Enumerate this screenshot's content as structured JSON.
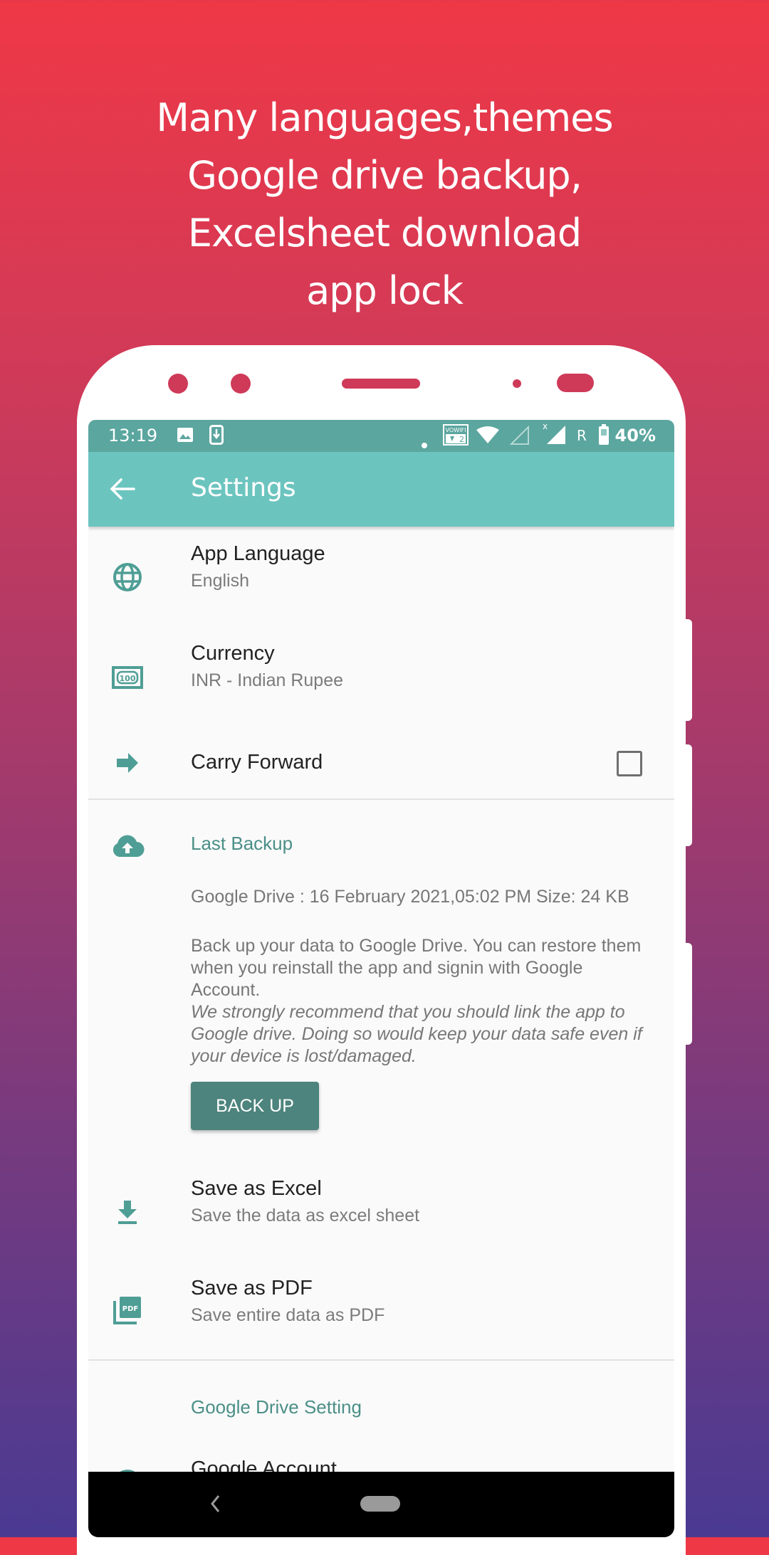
{
  "headline": {
    "lines": [
      "Many languages,themes",
      "Google drive backup,",
      "Excelsheet download",
      "app lock"
    ]
  },
  "colors": {
    "primary": "#6cc4bf",
    "primary_dark": "#5ba69f",
    "accent_text": "#4b8f87",
    "button": "#4d847d",
    "background_top": "#ef3846",
    "background_bottom": "#4a3a92"
  },
  "status_bar": {
    "time": "13:19",
    "left_icons": [
      "image-icon",
      "download-icon"
    ],
    "right_icons": [
      "dot-icon",
      "vowifi-icon",
      "wifi-icon",
      "signal-empty-icon",
      "signal-no-data-icon",
      "roaming-icon",
      "battery-icon"
    ],
    "roaming": "R",
    "vowifi": "VOWIFI",
    "battery_percent": "40%"
  },
  "toolbar": {
    "back_icon": "arrow-back-icon",
    "title": "Settings"
  },
  "settings": {
    "app_language": {
      "icon": "globe-icon",
      "title": "App Language",
      "summary": "English"
    },
    "currency": {
      "icon": "currency-note-icon",
      "title": "Currency",
      "summary": "INR - Indian Rupee"
    },
    "carry_forward": {
      "icon": "arrow-forward-icon",
      "title": "Carry Forward",
      "checked": false
    },
    "backup": {
      "icon": "cloud-upload-icon",
      "title": "Last Backup",
      "last_backup": "Google Drive : 16 February 2021,05:02 PM Size: 24 KB",
      "description": "Back up your data to Google Drive. You can restore them when you reinstall the app and signin with Google Account.",
      "recommendation": "We strongly recommend that you should link the app to Google drive. Doing so would keep your data safe even if your device is lost/damaged.",
      "button_label": "BACK UP"
    },
    "save_excel": {
      "icon": "download-icon",
      "title": "Save as Excel",
      "summary": "Save the data as excel sheet"
    },
    "save_pdf": {
      "icon": "pdf-icon",
      "title": "Save as PDF",
      "summary": "Save entire data as PDF",
      "icon_text": "PDF"
    },
    "drive_section": {
      "title": "Google Drive Setting"
    },
    "google_account": {
      "icon": "account-circle-icon",
      "title": "Google Account"
    }
  },
  "nav_bar": {
    "back": "nav-back-icon",
    "home": "nav-home-pill"
  }
}
